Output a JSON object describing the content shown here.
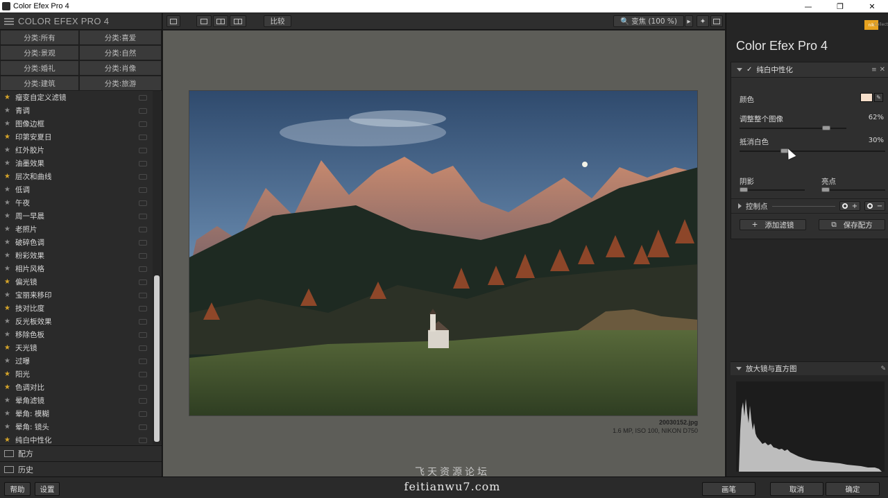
{
  "window": {
    "title": "Color Efex Pro 4"
  },
  "left": {
    "brand": "COLOR EFEX PRO 4",
    "categories": [
      "分类:所有",
      "分类:喜爱",
      "分类:景观",
      "分类:自然",
      "分类:婚礼",
      "分类:肖像",
      "分类:建筑",
      "分类:旅游"
    ],
    "filters": [
      {
        "name": "瘤变自定义滤镜",
        "fav": true
      },
      {
        "name": "青调",
        "fav": false
      },
      {
        "name": "图像边框",
        "fav": false
      },
      {
        "name": "印第安夏日",
        "fav": true
      },
      {
        "name": "红外胶片",
        "fav": false
      },
      {
        "name": "油墨效果",
        "fav": false
      },
      {
        "name": "层次和曲线",
        "fav": true
      },
      {
        "name": "低调",
        "fav": false
      },
      {
        "name": "午夜",
        "fav": false
      },
      {
        "name": "周一早晨",
        "fav": false
      },
      {
        "name": "老照片",
        "fav": false
      },
      {
        "name": "破碎色调",
        "fav": false
      },
      {
        "name": "粉彩效果",
        "fav": false
      },
      {
        "name": "相片风格",
        "fav": false
      },
      {
        "name": "偏光镜",
        "fav": true
      },
      {
        "name": "宝丽来移印",
        "fav": false
      },
      {
        "name": "技对比度",
        "fav": true
      },
      {
        "name": "反光板效果",
        "fav": false
      },
      {
        "name": "移除色板",
        "fav": false
      },
      {
        "name": "天光镜",
        "fav": true
      },
      {
        "name": "过曝",
        "fav": false
      },
      {
        "name": "阳光",
        "fav": true
      },
      {
        "name": "色调对比",
        "fav": true
      },
      {
        "name": "晕角滤镜",
        "fav": false
      },
      {
        "name": "晕角: 模糊",
        "fav": false
      },
      {
        "name": "晕角: 镜头",
        "fav": false
      },
      {
        "name": "纯白中性化",
        "fav": true
      }
    ],
    "sections": [
      "配方",
      "历史"
    ]
  },
  "toolbar": {
    "compare": "比较",
    "zoom": "变焦 (100 %)"
  },
  "image": {
    "filename": "20030152.jpg",
    "info": "1.6 MP, ISO 100, NIKON D750"
  },
  "right": {
    "title": "Color Efex Pro 4",
    "logo": "nik",
    "logo_text": "Collect",
    "filter_name": "纯白中性化",
    "color_label": "颜色",
    "adjust_label": "调整整个图像",
    "adjust_value": "62%",
    "adjust_level": 0.62,
    "remove_label": "抵消白色",
    "remove_value": "30%",
    "remove_level": 0.3,
    "shadow_label": "阴影",
    "highlight_label": "亮点",
    "control_points": "控制点",
    "add_filter": "添加滤镜",
    "save_recipe": "保存配方",
    "hist_label": "放大镜与直方图"
  },
  "bottom": {
    "help": "帮助",
    "settings": "设置",
    "brush": "画笔",
    "cancel": "取消",
    "ok": "确定"
  },
  "watermark": {
    "line1": "飞天资源论坛",
    "line2": "feitianwu7.com"
  },
  "colors": {
    "accent_star": "#d6a52a",
    "swatch": "#f6dfcb",
    "logo_bg": "#e7a21f"
  }
}
